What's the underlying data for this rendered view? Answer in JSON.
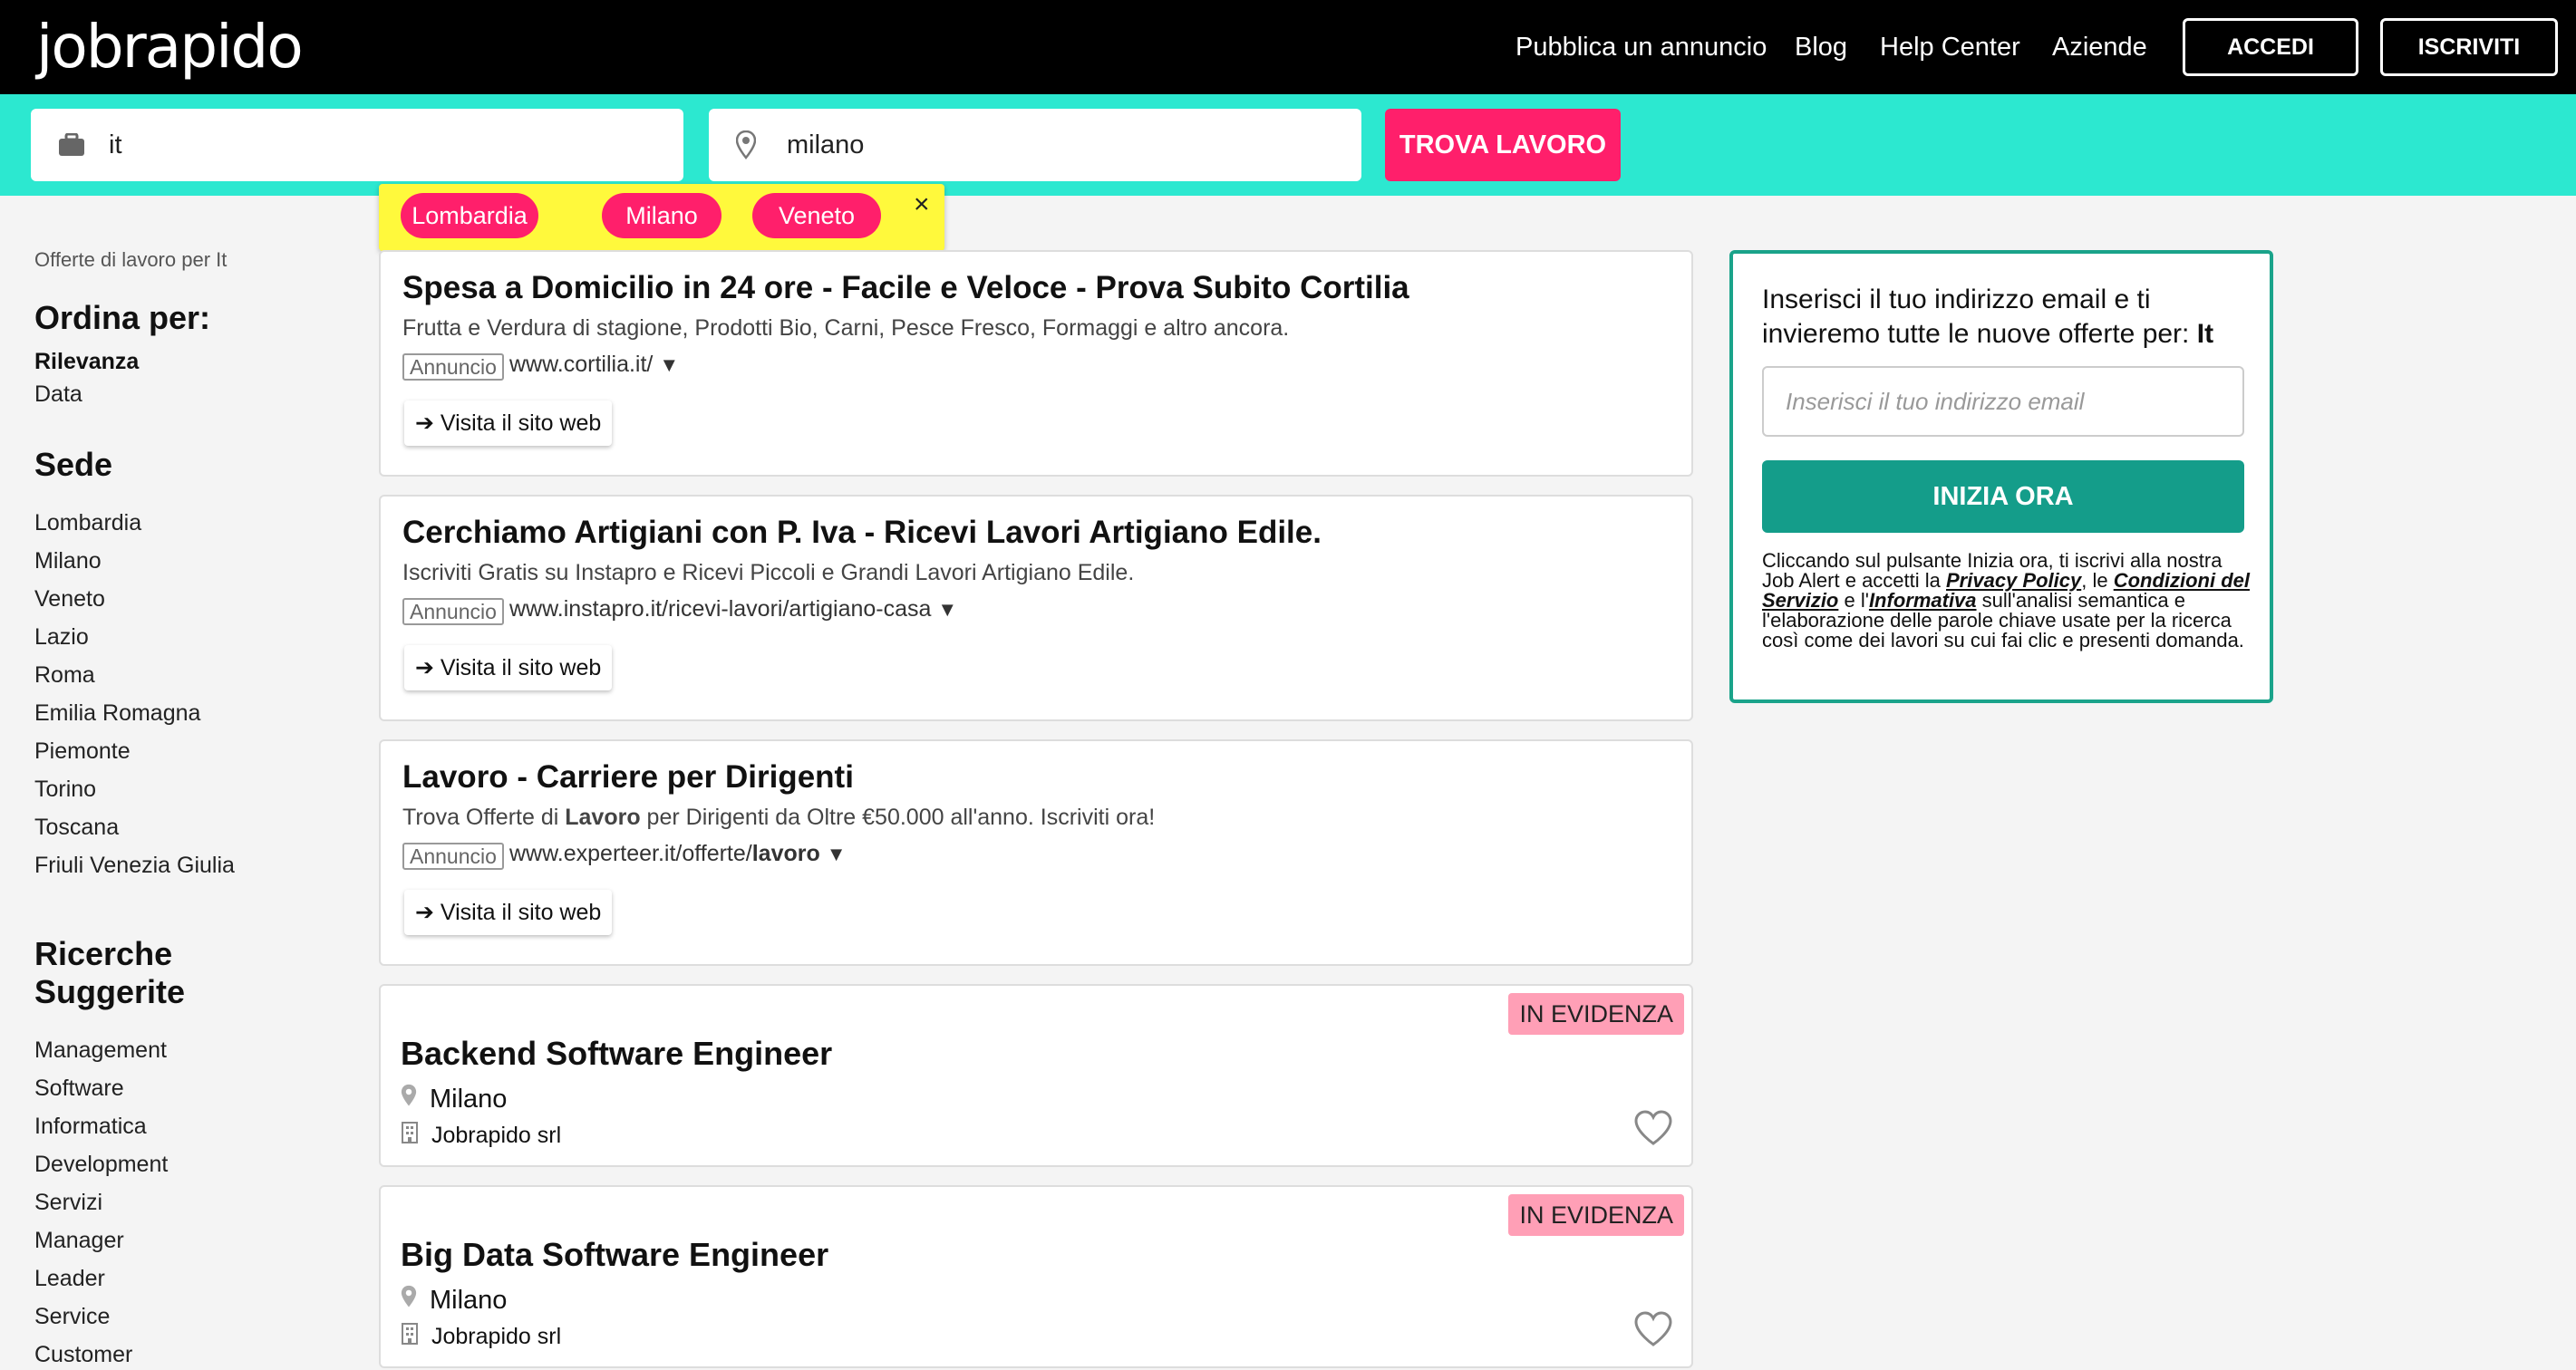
{
  "header": {
    "logo": "jobrapido",
    "nav": [
      "Pubblica un annuncio",
      "Blog",
      "Help Center",
      "Aziende"
    ],
    "login_label": "ACCEDI",
    "signup_label": "ISCRIVITI"
  },
  "search": {
    "keyword": "it",
    "location": "milano",
    "button_label": "TROVA LAVORO",
    "suggestions": [
      "Lombardia",
      "Milano",
      "Veneto"
    ],
    "close": "×"
  },
  "sidebar": {
    "caption": "Offerte di lavoro per It",
    "sort_heading": "Ordina per:",
    "sort_options": [
      "Rilevanza",
      "Data"
    ],
    "location_heading": "Sede",
    "locations": [
      "Lombardia",
      "Milano",
      "Veneto",
      "Lazio",
      "Roma",
      "Emilia Romagna",
      "Piemonte",
      "Torino",
      "Toscana",
      "Friuli Venezia Giulia"
    ],
    "suggested_heading_line1": "Ricerche",
    "suggested_heading_line2": "Suggerite",
    "suggested": [
      "Management",
      "Software",
      "Informatica",
      "Development",
      "Servizi",
      "Manager",
      "Leader",
      "Service",
      "Customer"
    ]
  },
  "ads": [
    {
      "title": "Spesa a Domicilio in 24 ore - Facile e Veloce - Prova Subito Cortilia",
      "desc": "Frutta e Verdura di stagione, Prodotti Bio, Carni, Pesce Fresco, Formaggi e altro ancora.",
      "label": "Annuncio",
      "url": "www.cortilia.it/",
      "visit": "➔ Visita il sito web"
    },
    {
      "title": "Cerchiamo Artigiani con P. Iva - Ricevi Lavori Artigiano Edile.",
      "desc": "Iscriviti Gratis su Instapro e Ricevi Piccoli e Grandi Lavori Artigiano Edile.",
      "label": "Annuncio",
      "url": "www.instapro.it/ricevi-lavori/artigiano-casa",
      "visit": "➔ Visita il sito web"
    },
    {
      "title": "Lavoro - Carriere per Dirigenti",
      "desc_pre": "Trova Offerte di ",
      "desc_bold": "Lavoro",
      "desc_post": " per Dirigenti da Oltre €50.000 all'anno. Iscriviti ora!",
      "label": "Annuncio",
      "url_pre": "www.experteer.it/offerte/",
      "url_bold": "lavoro",
      "visit": "➔ Visita il sito web"
    }
  ],
  "jobs": [
    {
      "badge": "IN EVIDENZA",
      "title": "Backend Software Engineer",
      "location": "Milano",
      "company": "Jobrapido srl"
    },
    {
      "badge": "IN EVIDENZA",
      "title": "Big Data Software Engineer",
      "location": "Milano",
      "company": "Jobrapido srl"
    }
  ],
  "alert": {
    "text": "Inserisci il tuo indirizzo email e ti invieremo tutte le nuove offerte per: ",
    "keyword": "It",
    "email_placeholder": "Inserisci il tuo indirizzo email",
    "button_label": "INIZIA ORA",
    "legal_1": "Cliccando sul pulsante Inizia ora, ti iscrivi alla nostra Job Alert e accetti la ",
    "privacy": "Privacy Policy",
    "legal_2": ", le ",
    "terms": "Condizioni del Servizio",
    "legal_3": " e l'",
    "info": "Informativa",
    "legal_4": " sull'analisi semantica e l'elaborazione delle parole chiave usate per la ricerca così come dei lavori su cui fai clic e presenti domanda."
  },
  "colors": {
    "teal": "#2ce8d0",
    "pink": "#ff1f6b",
    "green": "#149d8a",
    "badge": "#ff9fb6",
    "yellow": "#fff93c"
  }
}
